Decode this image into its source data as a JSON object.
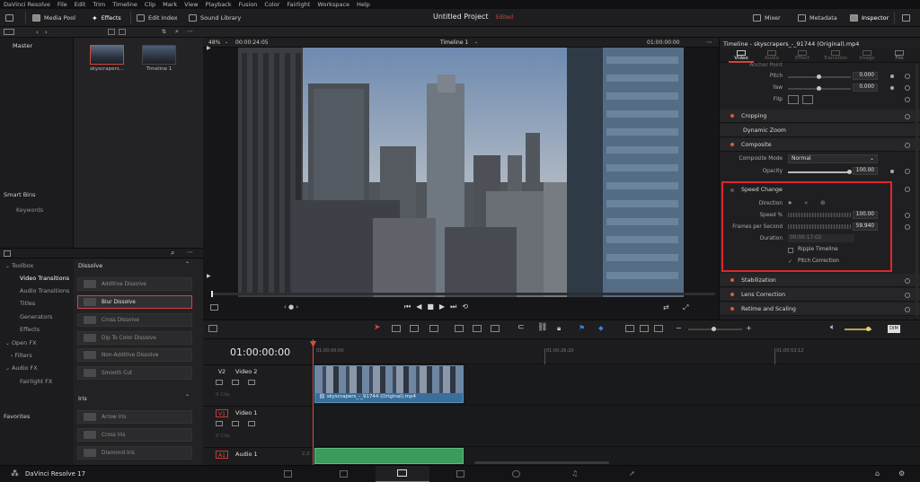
{
  "menu": [
    "DaVinci Resolve",
    "File",
    "Edit",
    "Trim",
    "Timeline",
    "Clip",
    "Mark",
    "View",
    "Playback",
    "Fusion",
    "Color",
    "Fairlight",
    "Workspace",
    "Help"
  ],
  "toolbar": {
    "media_pool": "Media Pool",
    "effects": "Effects",
    "edit_index": "Edit Index",
    "sound_library": "Sound Library",
    "project_title": "Untitled Project",
    "edited": "Edited",
    "mixer": "Mixer",
    "metadata": "Metadata",
    "inspector": "Inspector"
  },
  "viewer": {
    "zoom": "48%",
    "timecode_left": "00:00:24:05",
    "timeline_name": "Timeline 1",
    "timecode_right": "01:00:00:00"
  },
  "media_pool": {
    "bin_master": "Master",
    "clips": [
      {
        "label": "skyscrapers..."
      },
      {
        "label": "Timeline 1"
      }
    ],
    "smart_bins": "Smart Bins",
    "keywords": "Keywords"
  },
  "effects": {
    "tree": [
      {
        "label": "Toolbox",
        "level": 0
      },
      {
        "label": "Video Transitions",
        "level": 1,
        "selected": true
      },
      {
        "label": "Audio Transitions",
        "level": 1
      },
      {
        "label": "Titles",
        "level": 1
      },
      {
        "label": "Generators",
        "level": 1
      },
      {
        "label": "Effects",
        "level": 1
      },
      {
        "label": "Open FX",
        "level": 0
      },
      {
        "label": "Filters",
        "level": 1
      },
      {
        "label": "Audio FX",
        "level": 0
      },
      {
        "label": "Fairlight FX",
        "level": 1
      }
    ],
    "favorites": "Favorites",
    "dissolve_header": "Dissolve",
    "dissolve_items": [
      "Additive Dissolve",
      "Blur Dissolve",
      "Cross Dissolve",
      "Dip To Color Dissolve",
      "Non-Additive Dissolve",
      "Smooth Cut"
    ],
    "iris_header": "Iris",
    "iris_items": [
      "Arrow Iris",
      "Cross Iris",
      "Diamond Iris"
    ]
  },
  "inspector": {
    "title": "Timeline - skyscrapers_-_91744 (Original).mp4",
    "tabs": [
      "Video",
      "Audio",
      "Effect",
      "Transition",
      "Image",
      "File"
    ],
    "anchor_point": "Anchor Point",
    "pitch": {
      "label": "Pitch",
      "value": "0.000"
    },
    "yaw": {
      "label": "Yaw",
      "value": "0.000"
    },
    "flip": "Flip",
    "sections": {
      "cropping": "Cropping",
      "dynamic_zoom": "Dynamic Zoom",
      "composite": "Composite",
      "speed_change": "Speed Change",
      "stabilization": "Stabilization",
      "lens_correction": "Lens Correction",
      "retime_scaling": "Retime and Scaling"
    },
    "composite_mode": {
      "label": "Composite Mode",
      "value": "Normal"
    },
    "opacity": {
      "label": "Opacity",
      "value": "100.00"
    },
    "direction": "Direction",
    "speed": {
      "label": "Speed %",
      "value": "100.00"
    },
    "fps": {
      "label": "Frames per Second",
      "value": "59.940"
    },
    "duration": {
      "label": "Duration",
      "value": "00:00:17:02"
    },
    "ripple_timeline": "Ripple Timeline",
    "pitch_correction": "Pitch Correction"
  },
  "timeline": {
    "timecode": "01:00:00:00",
    "ruler": [
      "01:00:00:00",
      "01:00:26:20",
      "01:00:53:12"
    ],
    "tracks": [
      {
        "tag": "V2",
        "name": "Video 2",
        "clips": "0 Clip"
      },
      {
        "tag": "V1",
        "name": "Video 1",
        "clips": "0 Clip"
      },
      {
        "tag": "A1",
        "name": "Audio 1",
        "channel": "2.0"
      }
    ],
    "clip_label": "skyscrapers_-_91744 (Original).mp4",
    "dim_label": "DIM"
  },
  "footer": {
    "app_name": "DaVinci Resolve 17"
  },
  "colors": {
    "accent_red": "#d0453f",
    "clip_blue": "#3a6f9c",
    "audio_green": "#3b9a5c",
    "playhead": "#e04a3a"
  }
}
